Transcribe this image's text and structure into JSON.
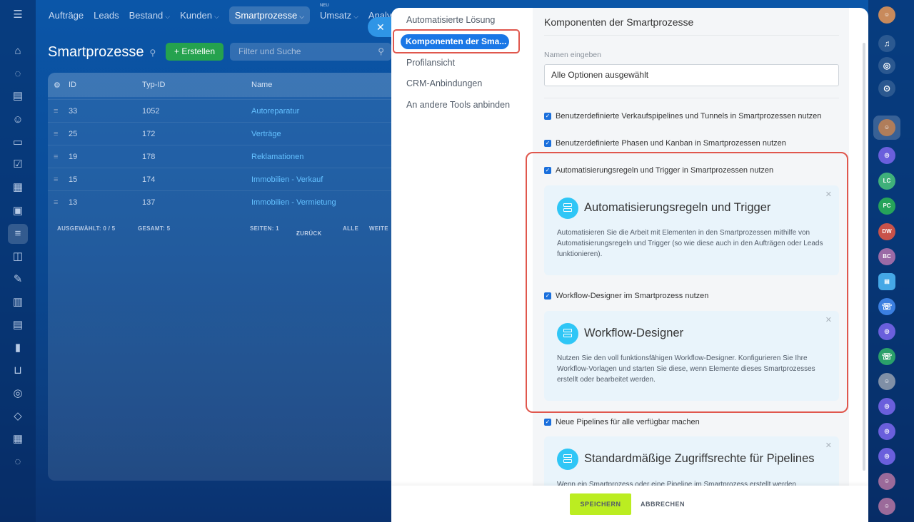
{
  "topmenu": {
    "items": [
      "Aufträge",
      "Leads",
      "Bestand",
      "Kunden",
      "Smartprozesse",
      "Umsatz",
      "Analytic"
    ],
    "badge_new": "NEU"
  },
  "page": {
    "title": "Smartprozesse",
    "create_label": "+ Erstellen",
    "search_placeholder": "Filter und Suche"
  },
  "grid": {
    "headers": [
      "ID",
      "Typ-ID",
      "Name"
    ],
    "rows": [
      {
        "id": "33",
        "type": "1052",
        "name": "Autoreparatur"
      },
      {
        "id": "25",
        "type": "172",
        "name": "Verträge"
      },
      {
        "id": "19",
        "type": "178",
        "name": "Reklamationen"
      },
      {
        "id": "15",
        "type": "174",
        "name": "Immobilien - Verkauf"
      },
      {
        "id": "13",
        "type": "137",
        "name": "Immobilien - Vermietung"
      }
    ],
    "footer": {
      "selected": "AUSGEWÄHLT: 0 / 5",
      "total": "GESAMT: 5",
      "pages": "SEITEN: 1",
      "back": "ZURÜCK",
      "all": "ALLE",
      "next": "WEITE"
    }
  },
  "rightbar": {
    "lc": "LC",
    "pc": "PC",
    "dw": "DW",
    "bc": "BC"
  },
  "slider": {
    "nav": [
      "Automatisierte Lösung",
      "Komponenten der Sma...",
      "Profilansicht",
      "CRM-Anbindungen",
      "An andere Tools anbinden"
    ],
    "title": "Komponenten der Smartprozesse",
    "name_label": "Namen eingeben",
    "name_value": "Alle Optionen ausgewählt",
    "checkboxes": [
      "Benutzerdefinierte Verkaufspipelines und Tunnels in Smartprozessen nutzen",
      "Benutzerdefinierte Phasen und Kanban in Smartprozessen nutzen",
      "Automatisierungsregeln und Trigger in Smartprozessen nutzen",
      "Workflow-Designer im Smartprozess nutzen",
      "Neue Pipelines für alle verfügbar machen"
    ],
    "cards": [
      {
        "title": "Automatisierungsregeln und Trigger",
        "text": "Automatisieren Sie die Arbeit mit Elementen in den Smartprozessen mithilfe von Automatisierungsregeln und Trigger (so wie diese auch in den Aufträgen oder Leads funktionieren)."
      },
      {
        "title": "Workflow-Designer",
        "text": "Nutzen Sie den voll funktionsfähigen Workflow-Designer. Konfigurieren Sie Ihre Workflow-Vorlagen und starten Sie diese, wenn Elemente dieses Smartprozesses erstellt oder bearbeitet werden."
      },
      {
        "title": "Standardmäßige Zugriffsrechte für Pipelines",
        "text": "Wenn ein Smartprozess oder eine Pipeline im Smartprozess erstellt werden"
      }
    ],
    "save_label": "SPEICHERN",
    "cancel_label": "ABBRECHEN"
  }
}
